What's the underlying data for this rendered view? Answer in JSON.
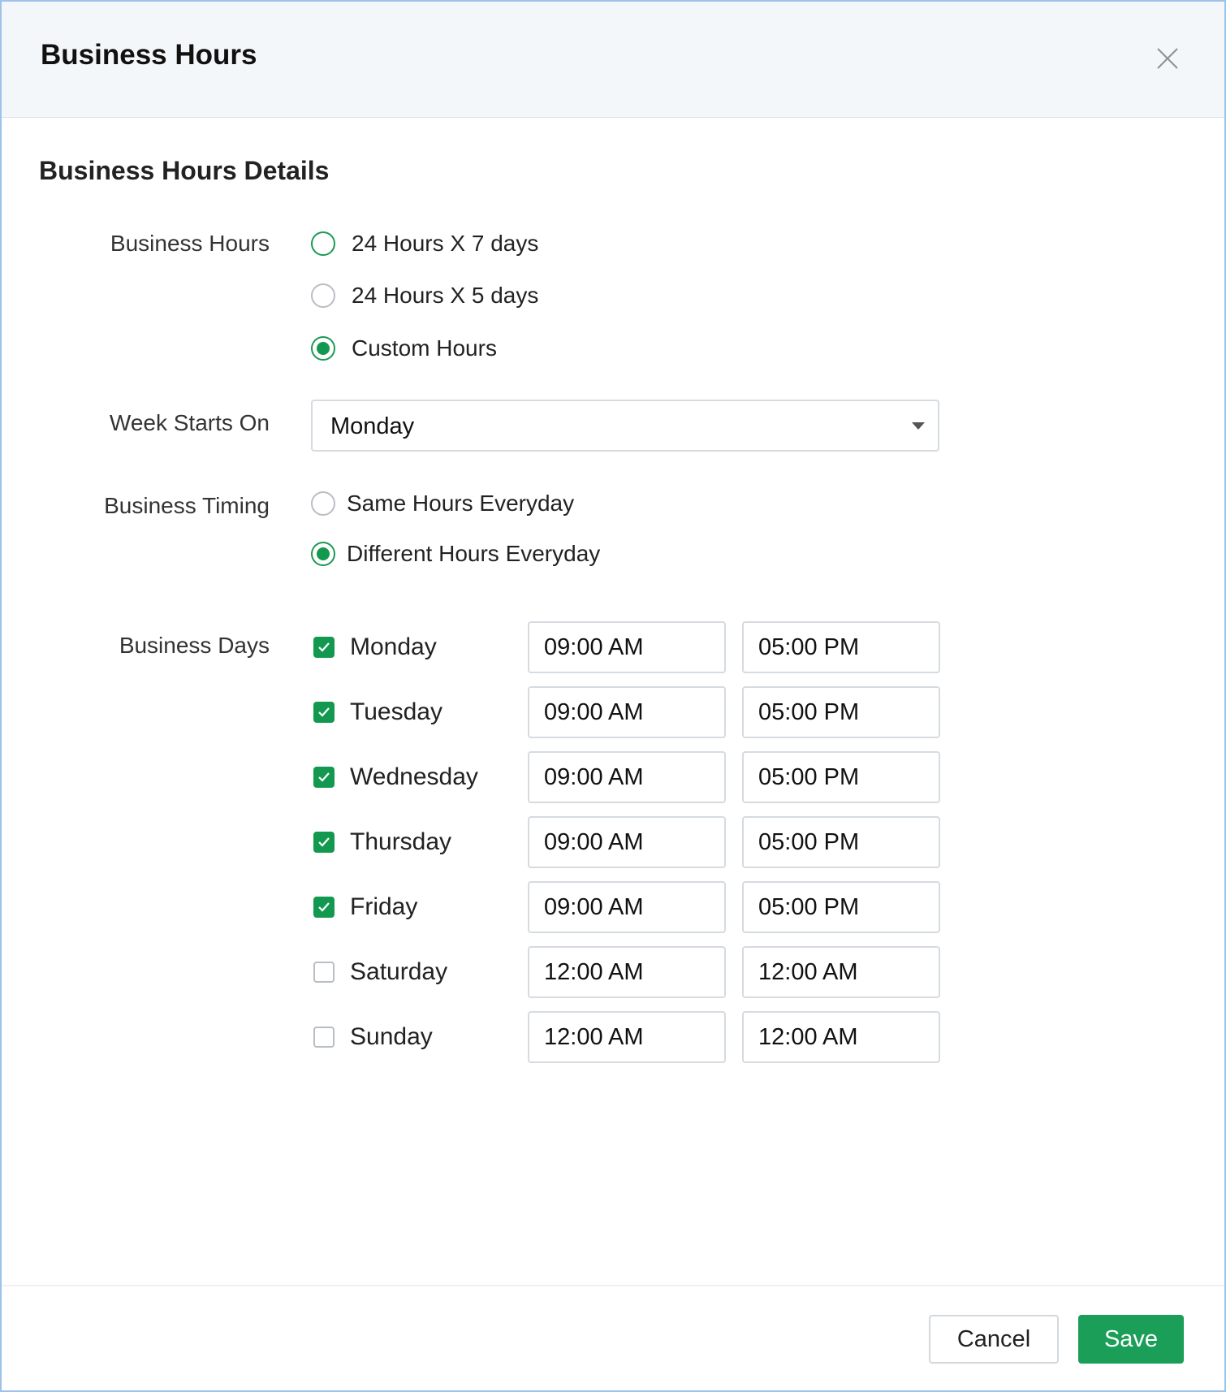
{
  "dialog": {
    "title": "Business Hours",
    "close_icon": "close-icon"
  },
  "section": {
    "title": "Business Hours Details"
  },
  "business_hours": {
    "label": "Business Hours",
    "options": [
      {
        "label": "24 Hours X 7 days",
        "selected": false
      },
      {
        "label": "24 Hours X 5 days",
        "selected": false
      },
      {
        "label": "Custom Hours",
        "selected": true
      }
    ]
  },
  "week_start": {
    "label": "Week Starts On",
    "value": "Monday"
  },
  "business_timing": {
    "label": "Business Timing",
    "options": [
      {
        "label": "Same Hours Everyday",
        "selected": false
      },
      {
        "label": "Different Hours Everyday",
        "selected": true
      }
    ]
  },
  "business_days": {
    "label": "Business Days",
    "days": [
      {
        "name": "Monday",
        "checked": true,
        "start": "09:00 AM",
        "end": "05:00 PM"
      },
      {
        "name": "Tuesday",
        "checked": true,
        "start": "09:00 AM",
        "end": "05:00 PM"
      },
      {
        "name": "Wednesday",
        "checked": true,
        "start": "09:00 AM",
        "end": "05:00 PM"
      },
      {
        "name": "Thursday",
        "checked": true,
        "start": "09:00 AM",
        "end": "05:00 PM"
      },
      {
        "name": "Friday",
        "checked": true,
        "start": "09:00 AM",
        "end": "05:00 PM"
      },
      {
        "name": "Saturday",
        "checked": false,
        "start": "12:00 AM",
        "end": "12:00 AM"
      },
      {
        "name": "Sunday",
        "checked": false,
        "start": "12:00 AM",
        "end": "12:00 AM"
      }
    ]
  },
  "footer": {
    "cancel_label": "Cancel",
    "save_label": "Save"
  },
  "colors": {
    "accent": "#13994f",
    "header_bg": "#f4f7f9",
    "border": "#d6dbe0"
  }
}
